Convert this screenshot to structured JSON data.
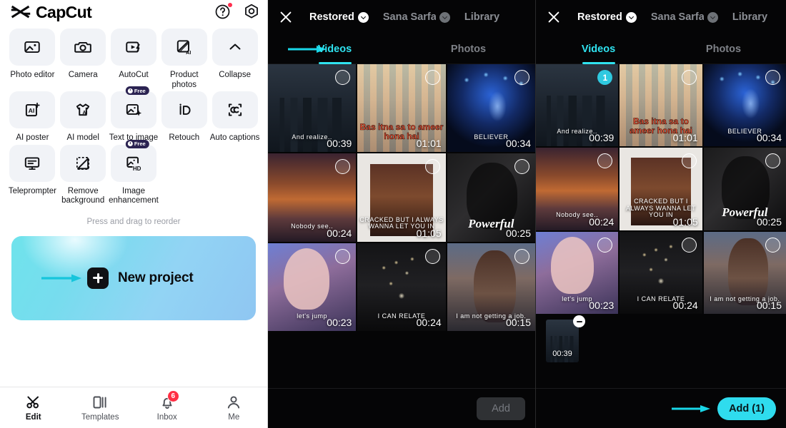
{
  "panel1": {
    "brand": "CapCut",
    "header_icons": [
      {
        "name": "help-icon",
        "has_dot": true
      },
      {
        "name": "settings-icon",
        "has_dot": false
      }
    ],
    "tools": [
      {
        "label": "Photo editor",
        "icon": "photo-editor-icon",
        "badge": null
      },
      {
        "label": "Camera",
        "icon": "camera-icon",
        "badge": null
      },
      {
        "label": "AutoCut",
        "icon": "autocut-icon",
        "badge": null
      },
      {
        "label": "Product photos",
        "icon": "product-photos-ai-icon",
        "badge": null
      },
      {
        "label": "Collapse",
        "icon": "chevron-up-icon",
        "badge": null
      },
      {
        "label": "AI poster",
        "icon": "ai-poster-icon",
        "badge": null
      },
      {
        "label": "AI model",
        "icon": "ai-model-icon",
        "badge": null
      },
      {
        "label": "Text to image",
        "icon": "text-to-image-icon",
        "badge": "Free"
      },
      {
        "label": "Retouch",
        "icon": "retouch-icon",
        "badge": null
      },
      {
        "label": "Auto captions",
        "icon": "auto-captions-icon",
        "badge": null
      },
      {
        "label": "Teleprompter",
        "icon": "teleprompter-icon",
        "badge": null
      },
      {
        "label": "Remove background",
        "icon": "remove-background-icon",
        "badge": null
      },
      {
        "label": "Image enhancement",
        "icon": "image-enhancement-hd-icon",
        "badge": "Free"
      }
    ],
    "reorder_hint": "Press and drag to reorder",
    "new_project": {
      "label": "New project",
      "gradient_from": "#6FE3EC",
      "gradient_to": "#8FC6F2",
      "arrow_color": "#16C5DC"
    },
    "bottom_nav": [
      {
        "label": "Edit",
        "icon": "scissors-icon",
        "active": true,
        "badge": null
      },
      {
        "label": "Templates",
        "icon": "templates-icon",
        "active": false,
        "badge": null
      },
      {
        "label": "Inbox",
        "icon": "bell-icon",
        "active": false,
        "badge": "6"
      },
      {
        "label": "Me",
        "icon": "person-icon",
        "active": false,
        "badge": null
      }
    ]
  },
  "picker_middle": {
    "close_icon": "close-icon",
    "albums": [
      {
        "name": "Restored",
        "active": true,
        "has_chevron": true,
        "chevron_style": "light"
      },
      {
        "name": "Sana Sarfara",
        "active": false,
        "has_chevron": true,
        "chevron_style": "dim"
      },
      {
        "name": "Library",
        "active": false,
        "has_chevron": false,
        "chevron_style": null
      }
    ],
    "tabs": [
      {
        "label": "Videos",
        "active": true
      },
      {
        "label": "Photos",
        "active": false
      }
    ],
    "has_tab_arrow": true,
    "accent_color": "#2FE3F0",
    "cells": [
      {
        "duration": "00:39",
        "art": "t-city",
        "caption": "And realize..",
        "cap_class": "cap-white cap-sm",
        "selected": false
      },
      {
        "duration": "01:01",
        "art": "t-person",
        "caption": "Bas itna sa to ameer hona hai",
        "cap_class": "cap-red",
        "selected": false
      },
      {
        "duration": "00:34",
        "art": "t-concert",
        "caption": "BELIEVER",
        "cap_class": "cap-white cap-sm",
        "selected": false
      },
      {
        "duration": "00:24",
        "art": "t-sunset",
        "caption": "Nobody  see..",
        "cap_class": "cap-white cap-sm",
        "selected": false
      },
      {
        "duration": "01:05",
        "art": "t-album",
        "caption": "CRACKED BUT I ALWAYS WANNA LET YOU IN",
        "cap_class": "cap-white cap-sm",
        "selected": false
      },
      {
        "duration": "00:25",
        "art": "t-dark",
        "caption": "Powerful",
        "cap_class": "cap-script",
        "selected": false
      },
      {
        "duration": "00:23",
        "art": "t-stage",
        "caption": "let's jump",
        "cap_class": "cap-white cap-sm",
        "selected": false
      },
      {
        "duration": "00:24",
        "art": "t-street",
        "caption": "I  CAN  RELATE",
        "cap_class": "cap-white cap-sm",
        "selected": false
      },
      {
        "duration": "00:15",
        "art": "t-girl",
        "caption": "I am not getting a job.",
        "cap_class": "cap-white cap-sm",
        "selected": false
      }
    ],
    "tray_items": [],
    "add_button": {
      "label": "Add",
      "enabled": false
    },
    "has_add_arrow": false
  },
  "picker_right": {
    "close_icon": "close-icon",
    "albums": [
      {
        "name": "Restored",
        "active": true,
        "has_chevron": true,
        "chevron_style": "light"
      },
      {
        "name": "Sana Sarfara",
        "active": false,
        "has_chevron": true,
        "chevron_style": "dim"
      },
      {
        "name": "Library",
        "active": false,
        "has_chevron": false,
        "chevron_style": null
      }
    ],
    "tabs": [
      {
        "label": "Videos",
        "active": true
      },
      {
        "label": "Photos",
        "active": false
      }
    ],
    "has_tab_arrow": false,
    "accent_color": "#2FE3F0",
    "cells": [
      {
        "duration": "00:39",
        "art": "t-city",
        "caption": "And realize..",
        "cap_class": "cap-white cap-sm",
        "selected": true,
        "selection_number": "1"
      },
      {
        "duration": "01:01",
        "art": "t-person",
        "caption": "Bas itna sa to ameer hona hai",
        "cap_class": "cap-red",
        "selected": false
      },
      {
        "duration": "00:34",
        "art": "t-concert",
        "caption": "BELIEVER",
        "cap_class": "cap-white cap-sm",
        "selected": false
      },
      {
        "duration": "00:24",
        "art": "t-sunset",
        "caption": "Nobody  see..",
        "cap_class": "cap-white cap-sm",
        "selected": false
      },
      {
        "duration": "01:05",
        "art": "t-album",
        "caption": "CRACKED BUT I ALWAYS WANNA LET YOU IN",
        "cap_class": "cap-white cap-sm",
        "selected": false
      },
      {
        "duration": "00:25",
        "art": "t-dark",
        "caption": "Powerful",
        "cap_class": "cap-script",
        "selected": false
      },
      {
        "duration": "00:23",
        "art": "t-stage",
        "caption": "let's jump",
        "cap_class": "cap-white cap-sm",
        "selected": false
      },
      {
        "duration": "00:24",
        "art": "t-street",
        "caption": "I  CAN  RELATE",
        "cap_class": "cap-white cap-sm",
        "selected": false
      },
      {
        "duration": "00:15",
        "art": "t-girl",
        "caption": "I am not getting a job.",
        "cap_class": "cap-white cap-sm",
        "selected": false
      }
    ],
    "tray_items": [
      {
        "duration": "00:39",
        "art": "t-city",
        "remove_icon": "remove-icon"
      }
    ],
    "add_button": {
      "label": "Add (1)",
      "enabled": true
    },
    "has_add_arrow": true
  }
}
